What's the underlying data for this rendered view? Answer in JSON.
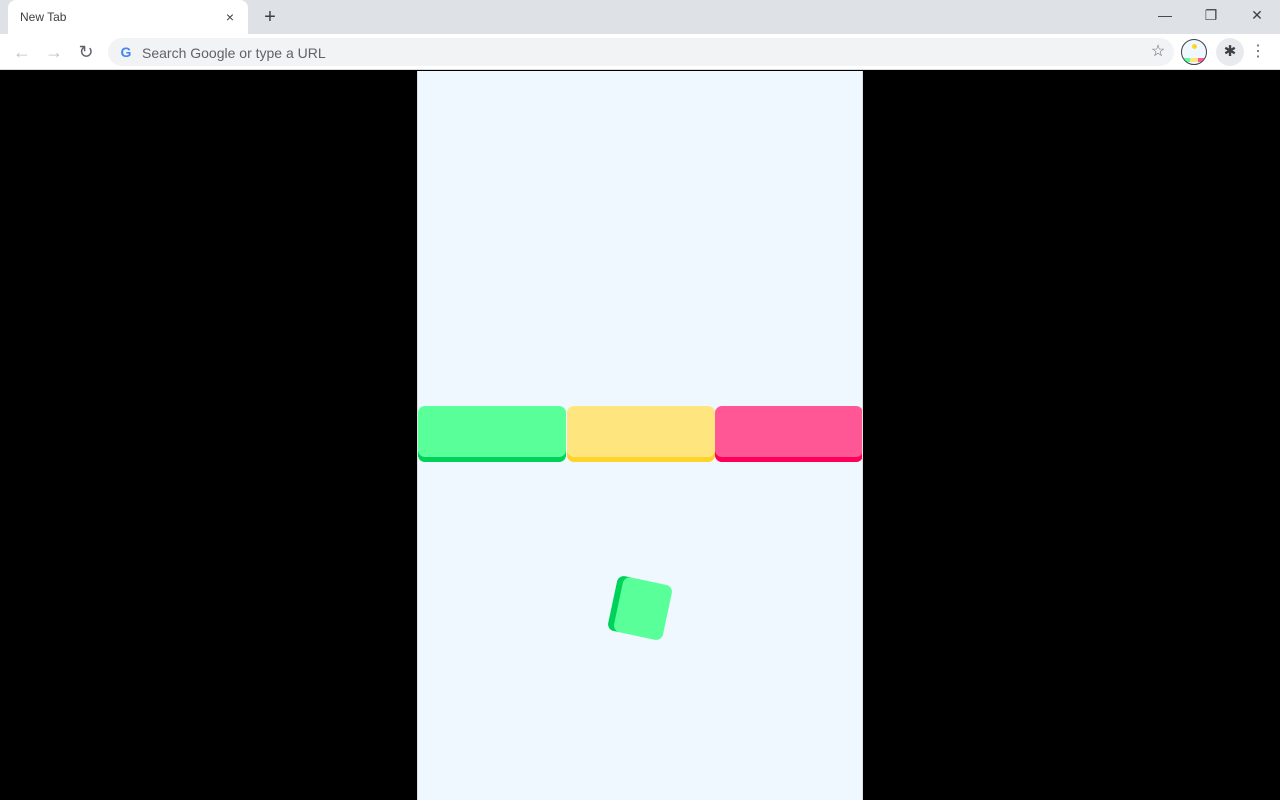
{
  "browser": {
    "tab_title": "New Tab",
    "tab_close_icon": "×",
    "new_tab_icon": "+",
    "minimize_icon": "—",
    "restore_icon": "❐",
    "close_icon": "✕",
    "back_icon": "←",
    "forward_icon": "→",
    "reload_icon": "↻",
    "omnibox_placeholder": "Search Google or type a URL",
    "google_icon": "G",
    "bookmark_icon": "☆",
    "extensions_icon": "✱",
    "menu_icon": "⋮"
  },
  "game": {
    "background": "#f0f8ff",
    "blocks": [
      {
        "name": "green",
        "color": "#59ff98",
        "shadow": "#00d158"
      },
      {
        "name": "yellow",
        "color": "#ffe57e",
        "shadow": "#ffd42a"
      },
      {
        "name": "pink",
        "color": "#ff5796",
        "shadow": "#ff0058"
      }
    ],
    "player": {
      "color": "#59ff98",
      "shadow": "#00d158"
    }
  }
}
